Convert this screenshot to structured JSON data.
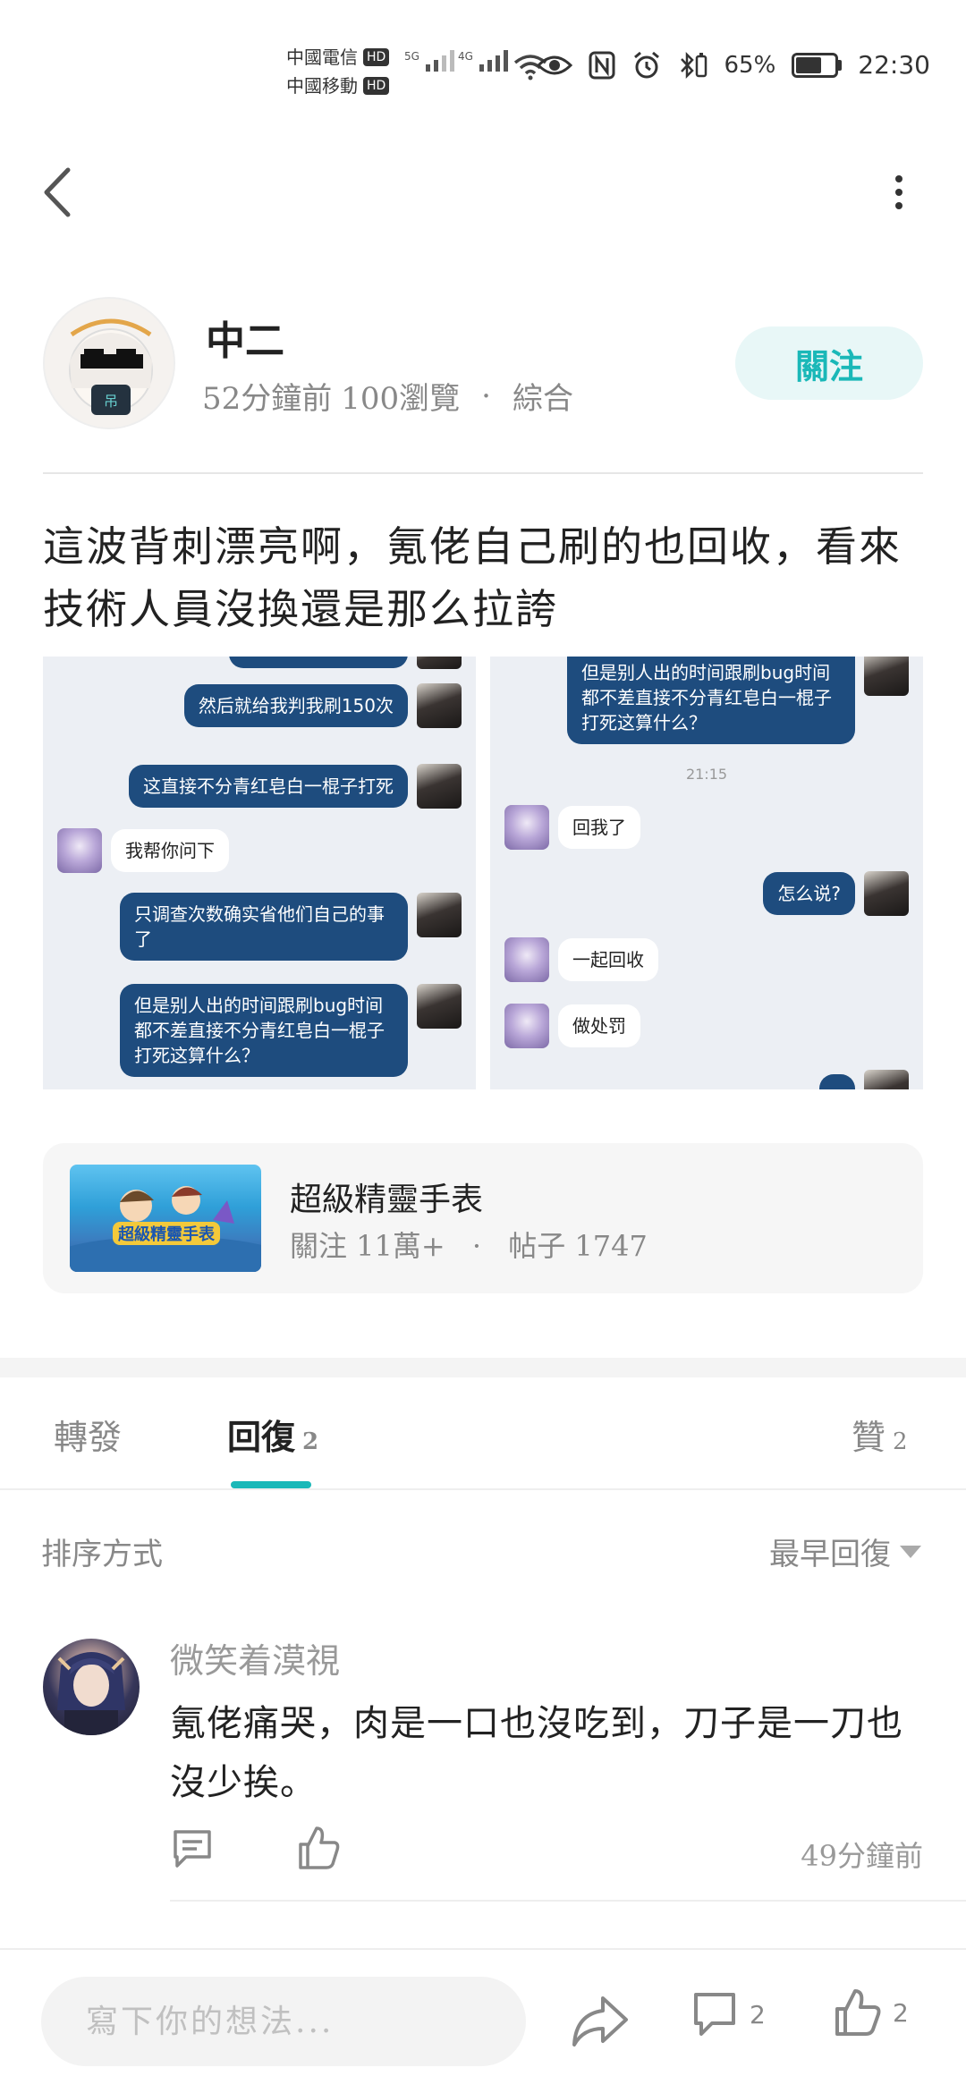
{
  "status_bar": {
    "carrier1": "中國電信",
    "carrier2": "中國移動",
    "hd": "HD",
    "net1": "5G",
    "net2": "4G",
    "battery": "65%",
    "time": "22:30"
  },
  "author": {
    "name": "中二",
    "time_ago": "52分鐘前",
    "views": "100瀏覽",
    "separator": "·",
    "category": "綜合",
    "follow_label": "關注"
  },
  "post": {
    "text": "這波背刺漂亮啊，氪佬自己刷的也回收，看來技術人員沒換還是那么拉誇"
  },
  "screenshot_left": {
    "messages": [
      {
        "side": "right",
        "text": "然后就给我判我刷150次"
      },
      {
        "side": "right",
        "text": "这直接不分青红皂白一棍子打死"
      },
      {
        "side": "left",
        "text": "我帮你问下"
      },
      {
        "side": "right",
        "text": "只调查次数确实省他们自己的事了"
      },
      {
        "side": "right",
        "text": "但是别人出的时间跟刷bug时间都不差直接不分青红皂白一棍子打死这算什么？"
      }
    ]
  },
  "screenshot_right": {
    "top_message": "但是别人出的时间跟刷bug时间都不差直接不分青红皂白一棍子打死这算什么？",
    "timestamp": "21:15",
    "messages": [
      {
        "side": "left",
        "text": "回我了"
      },
      {
        "side": "right",
        "text": "怎么说?"
      },
      {
        "side": "left",
        "text": "一起回收"
      },
      {
        "side": "left",
        "text": "做处罚"
      }
    ]
  },
  "forum": {
    "name": "超級精靈手表",
    "followers": "關注 11萬+",
    "separator": "·",
    "posts": "帖子 1747"
  },
  "tabs": {
    "forward": "轉發",
    "reply": "回復",
    "reply_count": "2",
    "like": "贊",
    "like_count": "2"
  },
  "sort": {
    "label": "排序方式",
    "value": "最早回復"
  },
  "comment": {
    "name": "微笑着漠視",
    "text": "氪佬痛哭，肉是一口也沒吃到，刀子是一刀也沒少挨。",
    "time": "49分鐘前"
  },
  "bottom_bar": {
    "placeholder": "寫下你的想法...",
    "comment_count": "2",
    "like_count": "2"
  },
  "colors": {
    "accent": "#1ab8b8",
    "bubble_blue": "#1e4c7e"
  }
}
